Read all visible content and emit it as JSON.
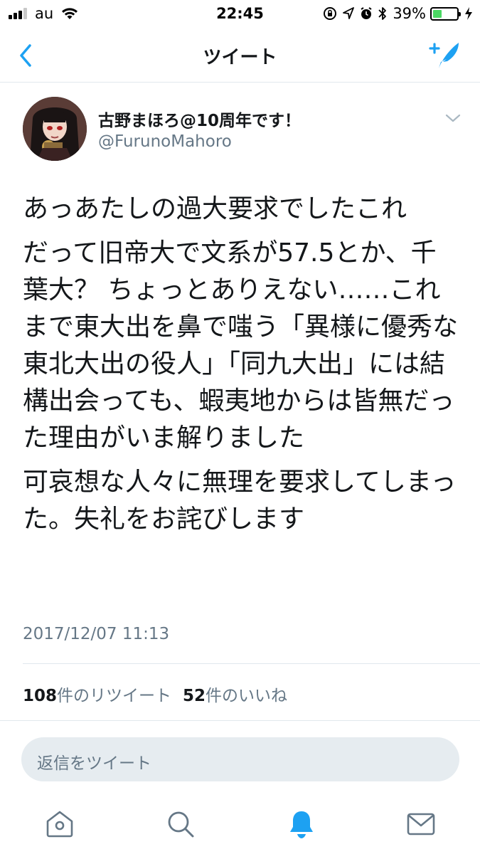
{
  "status_bar": {
    "carrier": "au",
    "time": "22:45",
    "battery_percent": "39%",
    "battery_level": 0.39,
    "icons": [
      "wifi-icon",
      "lock-rotation-icon",
      "location-icon",
      "alarm-icon",
      "bluetooth-icon",
      "charging-icon"
    ]
  },
  "nav": {
    "title": "ツイート",
    "back_icon": "chevron-left-icon",
    "compose_icon": "compose-tweet-icon"
  },
  "tweet": {
    "display_name": "古野まほろ@10周年です！",
    "handle": "@FurunoMahoro",
    "paragraphs": [
      "あっあたしの過大要求でしたこれ",
      "だって旧帝大で文系が57.5とか、千葉大？ ちょっとありえない……これまで東大出を鼻で嗤う「異様に優秀な東北大出の役人」「同九大出」には結構出会っても、蝦夷地からは皆無だった理由がいま解りました",
      "可哀想な人々に無理を要求してしまった。失礼をお詫びします"
    ],
    "timestamp": "2017/12/07 11:13",
    "retweet_count": "108",
    "retweet_label": "件のリツイート",
    "like_count": "52",
    "like_label": "件のいいね"
  },
  "reply": {
    "placeholder": "返信をツイート"
  },
  "tabbar": {
    "items": [
      {
        "icon": "home-icon",
        "active": false
      },
      {
        "icon": "search-icon",
        "active": false
      },
      {
        "icon": "notifications-bell-icon",
        "active": true
      },
      {
        "icon": "messages-envelope-icon",
        "active": false
      }
    ]
  },
  "colors": {
    "accent": "#1da1f2",
    "secondary_text": "#657786",
    "reply_bg": "#e6ecf0",
    "battery": "#4cd964"
  }
}
